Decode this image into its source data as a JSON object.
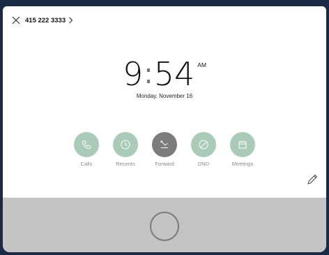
{
  "header": {
    "number": "415 222 3333",
    "close_icon": "close-icon",
    "chevron_icon": "chevron-right-icon"
  },
  "clock": {
    "hour": "9",
    "separator": ":",
    "minutes": "54",
    "ampm": "AM",
    "date": "Monday, November 16"
  },
  "actions": [
    {
      "label": "Calls",
      "icon": "phone-icon",
      "active": false
    },
    {
      "label": "Recents",
      "icon": "clock-icon",
      "active": false
    },
    {
      "label": "Forward",
      "icon": "forward-arrow-icon",
      "active": true
    },
    {
      "label": "DND",
      "icon": "dnd-icon",
      "active": false
    },
    {
      "label": "Meetings",
      "icon": "calendar-icon",
      "active": false
    }
  ],
  "colors": {
    "background": "#1b2a44",
    "action_circle": "#aacbb7",
    "action_circle_active": "#7c7c7c",
    "bottom_bar": "#c4c4c4"
  },
  "edit_icon": "pencil-icon",
  "home_icon": "home-circle-icon"
}
